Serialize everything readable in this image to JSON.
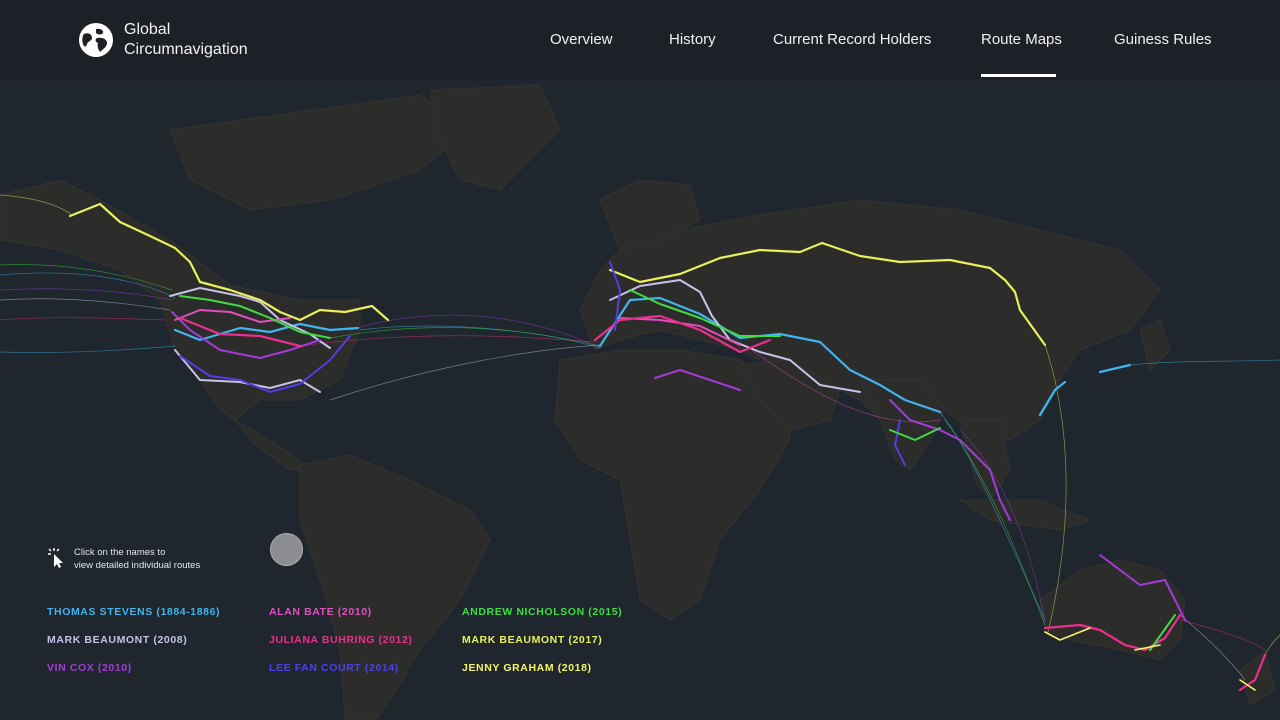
{
  "brand": {
    "line1": "Global",
    "line2": "Circumnavigation",
    "logo_icon": "globe-icon"
  },
  "nav": {
    "items": [
      {
        "label": "Overview",
        "active": false
      },
      {
        "label": "History",
        "active": false
      },
      {
        "label": "Current Record Holders",
        "active": false
      },
      {
        "label": "Route Maps",
        "active": true
      },
      {
        "label": "Guiness Rules",
        "active": false
      }
    ]
  },
  "hint": {
    "line1": "Click on the names to",
    "line2": "view detailed individual routes",
    "icon": "cursor-click-icon"
  },
  "legend": [
    {
      "label": "THOMAS STEVENS (1884-1886)",
      "color": "#3fb6ef"
    },
    {
      "label": "MARK BEAUMONT (2008)",
      "color": "#c6c2e8"
    },
    {
      "label": "VIN COX (2010)",
      "color": "#a43ad9"
    },
    {
      "label": "ALAN BATE (2010)",
      "color": "#e14ec0"
    },
    {
      "label": "JULIANA BUHRING (2012)",
      "color": "#ea2f8c"
    },
    {
      "label": "LEE FAN COURT (2014)",
      "color": "#4e3fe6"
    },
    {
      "label": "ANDREW NICHOLSON (2015)",
      "color": "#3fdc42"
    },
    {
      "label": "MARK BEAUMONT (2017)",
      "color": "#e8f05a"
    },
    {
      "label": "JENNY GRAHAM (2018)",
      "color": "#f4f66a"
    }
  ],
  "colors": {
    "background": "#1d2024",
    "land": "#2b2b2a",
    "ocean": "#1e252d",
    "accent": "#ffffff"
  }
}
